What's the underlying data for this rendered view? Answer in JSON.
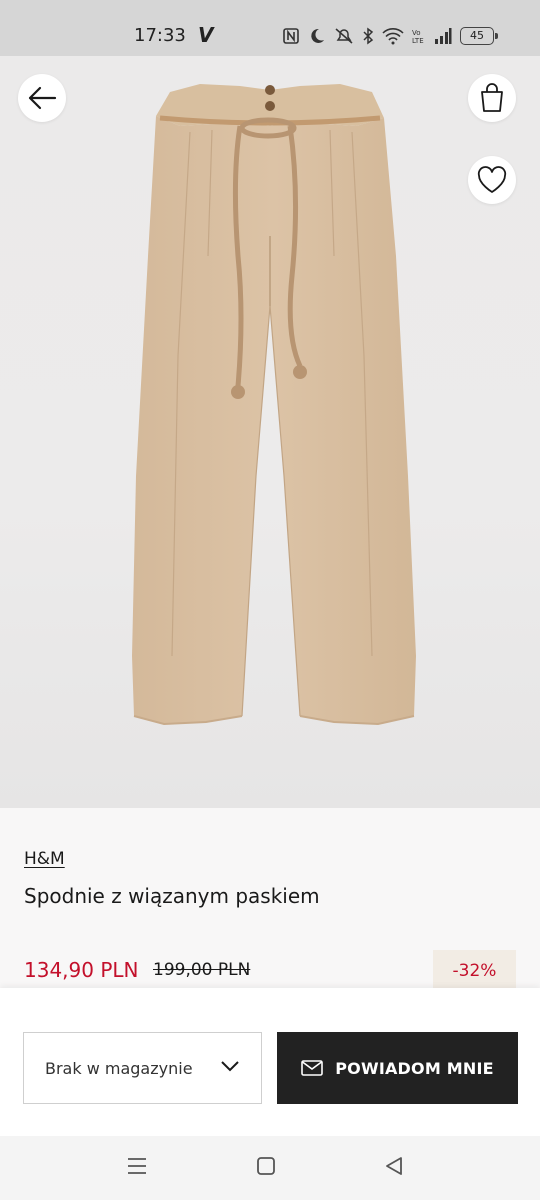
{
  "status_bar": {
    "time": "17:33",
    "carrier_mark": "V",
    "icons": [
      "nfc-icon",
      "moon-icon",
      "mute-icon",
      "bluetooth-icon",
      "wifi-icon",
      "volte-icon",
      "signal-icon"
    ],
    "battery": "45"
  },
  "gallery": {
    "image": "beige-high-waist-trousers-with-rope-belt",
    "background_color": "#ebeaea",
    "product_color": "#d9c0a3",
    "page_count": 2,
    "active_page": 1
  },
  "top_actions": {
    "back_icon": "arrow-left-icon",
    "bag_icon": "shopping-bag-icon",
    "favorite_icon": "heart-outline-icon"
  },
  "product": {
    "brand": "H&M",
    "title": "Spodnie z wiązanym paskiem",
    "price_current": "134,90 PLN",
    "price_original": "199,00 PLN",
    "discount": "-32%",
    "price_color": "#c3102b"
  },
  "actions": {
    "size_select_value": "Brak w magazynie",
    "notify_label": "POWIADOM MNIE",
    "notify_icon": "envelope-icon"
  },
  "nav_bar": {
    "icons": [
      "menu-icon",
      "home-square-icon",
      "back-triangle-icon"
    ]
  }
}
